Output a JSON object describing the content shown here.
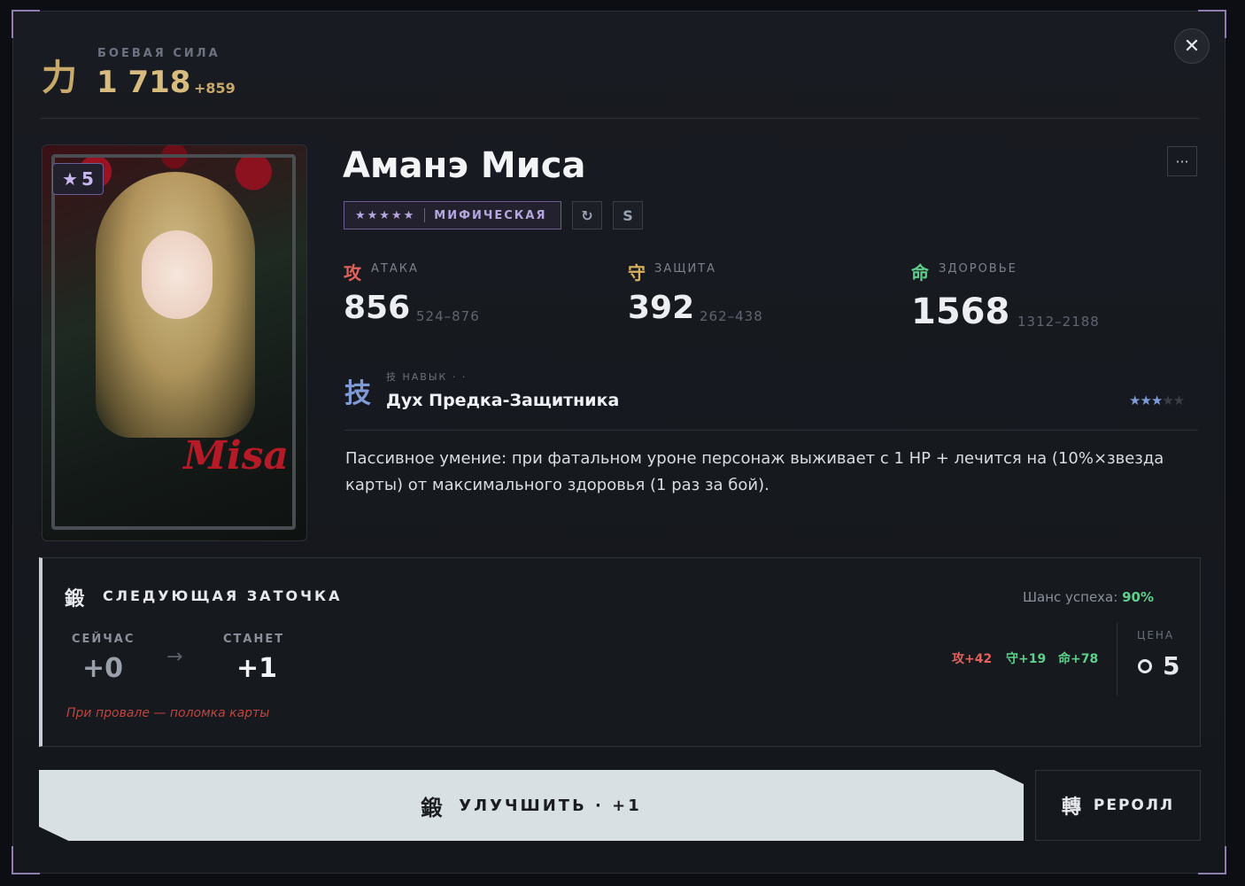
{
  "power": {
    "glyph": "力",
    "label": "БОЕВАЯ СИЛА",
    "value": "1 718",
    "delta": "+859"
  },
  "close_icon": "✕",
  "card": {
    "star_icon": "★",
    "star_count": "5",
    "art_text": "Misa"
  },
  "character": {
    "name": "Аманэ Миса",
    "rarity_stars": "★★★★★",
    "rarity_label": "МИФИЧЕСКАЯ",
    "refresh_icon": "↻",
    "grade": "S",
    "more_icon": "···"
  },
  "stats": {
    "attack": {
      "glyph": "攻",
      "label": "АТАКА",
      "value": "856",
      "range": "524–876",
      "color": "#e0625c"
    },
    "defense": {
      "glyph": "守",
      "label": "ЗАЩИТА",
      "value": "392",
      "range": "262–438",
      "color": "#d9b25f"
    },
    "health": {
      "glyph": "命",
      "label": "ЗДОРОВЬЕ",
      "value": "1568",
      "range": "1312–2188",
      "color": "#5fd08b"
    }
  },
  "skill": {
    "glyph": "技",
    "label": "技 НАВЫК · ·",
    "name": "Дух Предка-Защитника",
    "stars_filled": "★★★",
    "stars_empty": "★★",
    "description": "Пассивное умение: при фатальном уроне персонаж выживает с 1 HP + лечится на (10%×звезда карты) от максимального здоровья (1 раз за бой)."
  },
  "enhance": {
    "glyph": "鍛",
    "title": "СЛЕДУЮЩАЯ ЗАТОЧКА",
    "chance_label": "Шанс успеха:",
    "chance_value": "90%",
    "current_label": "СЕЙЧАС",
    "current_value": "+0",
    "arrow": "→",
    "next_label": "СТАНЕТ",
    "next_value": "+1",
    "fail_text": "При провале — поломка карты",
    "gain_attack": "攻+42",
    "gain_defense": "守+19",
    "gain_health": "命+78",
    "price_label": "ЦЕНА",
    "price_value": "5"
  },
  "buttons": {
    "upgrade_glyph": "鍛",
    "upgrade_label": "УЛУЧШИТЬ · +1",
    "reroll_glyph": "轉",
    "reroll_label": "РЕРОЛЛ"
  },
  "colors": {
    "accent": "#8f7fb0",
    "gold": "#d8bb7f",
    "success": "#5fd08b",
    "danger": "#c0443f"
  }
}
